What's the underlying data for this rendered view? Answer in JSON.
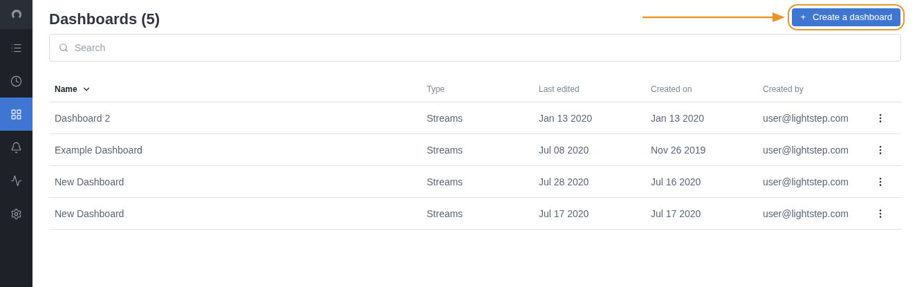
{
  "sidebar": {
    "items": [
      {
        "kind": "logo",
        "selected": false
      },
      {
        "kind": "list",
        "selected": false
      },
      {
        "kind": "clock",
        "selected": false
      },
      {
        "kind": "grid",
        "selected": true
      },
      {
        "kind": "bell",
        "selected": false
      },
      {
        "kind": "pulse",
        "selected": false
      },
      {
        "kind": "gear",
        "selected": false
      }
    ]
  },
  "title": "Dashboards (5)",
  "create_button": {
    "icon": "+",
    "label": "Create a dashboard",
    "highlighted": true
  },
  "search": {
    "placeholder": "Search"
  },
  "table": {
    "columns": [
      {
        "label": "Name",
        "sorted": true
      },
      {
        "label": "Type",
        "sorted": false
      },
      {
        "label": "Last edited",
        "sorted": false
      },
      {
        "label": "Created on",
        "sorted": false
      },
      {
        "label": "Created by",
        "sorted": false
      }
    ],
    "rows": [
      [
        "Dashboard 2",
        "Streams",
        "Jan 13 2020",
        "Jan 13 2020",
        "user@lightstep.com"
      ],
      [
        "Example Dashboard",
        "Streams",
        "Jul 08 2020",
        "Nov 26 2019",
        "user@lightstep.com"
      ],
      [
        "New Dashboard",
        "Streams",
        "Jul 28 2020",
        "Jul 16 2020",
        "user@lightstep.com"
      ],
      [
        "New Dashboard",
        "Streams",
        "Jul 17 2020",
        "Jul 17 2020",
        "user@lightstep.com"
      ]
    ]
  }
}
